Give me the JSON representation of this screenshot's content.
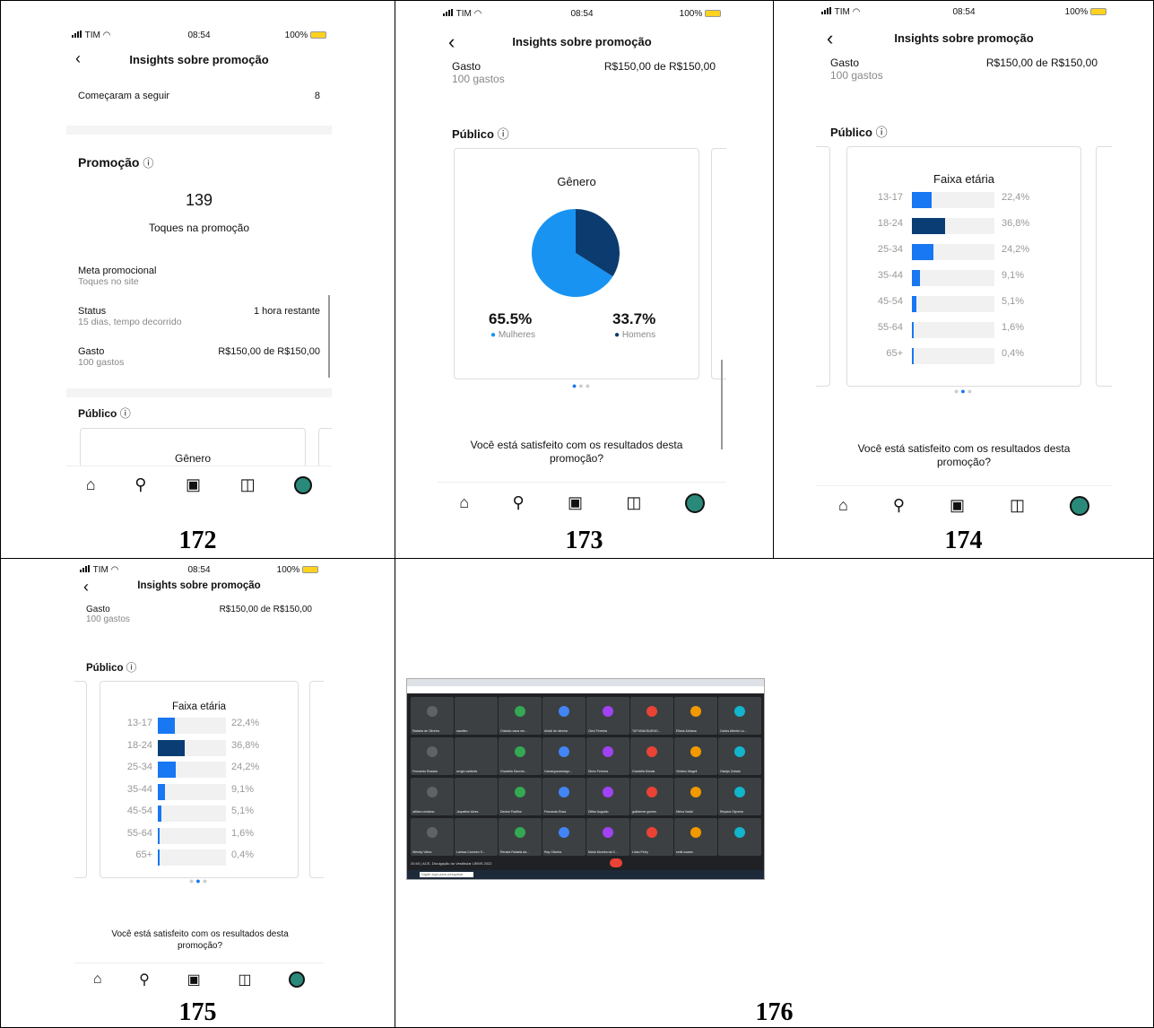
{
  "status": {
    "carrier": "TIM",
    "time": "08:54",
    "battery": "100%"
  },
  "header": {
    "title": "Insights sobre promoção"
  },
  "screens": {
    "s172": {
      "caption": "172",
      "follow_label": "Começaram a seguir",
      "follow_value": "8",
      "promo_title": "Promoção",
      "promo_value": "139",
      "promo_label": "Toques na promoção",
      "goal_label": "Meta promocional",
      "goal_sub": "Toques no site",
      "status_label": "Status",
      "status_sub": "15 dias, tempo decorrido",
      "status_value": "1 hora restante",
      "spend_label": "Gasto",
      "spend_sub": "100 gastos",
      "spend_value": "R$150,00 de R$150,00",
      "public_title": "Público",
      "gender_title": "Gênero"
    },
    "s173": {
      "caption": "173",
      "spend_label": "Gasto",
      "spend_sub": "100 gastos",
      "spend_value": "R$150,00 de R$150,00",
      "public_title": "Público",
      "gender_title": "Gênero",
      "women_pct": "65.5%",
      "women_label": "Mulheres",
      "men_pct": "33.7%",
      "men_label": "Homens",
      "question": "Você está satisfeito com os resultados desta promoção?"
    },
    "s174": {
      "caption": "174",
      "spend_label": "Gasto",
      "spend_sub": "100 gastos",
      "spend_value": "R$150,00 de R$150,00",
      "public_title": "Público",
      "age_title": "Faixa etária",
      "question": "Você está satisfeito com os resultados desta promoção?"
    },
    "s175": {
      "caption": "175",
      "spend_label": "Gasto",
      "spend_sub": "100 gastos",
      "spend_value": "R$150,00 de R$150,00",
      "public_title": "Público",
      "age_title": "Faixa etária",
      "question": "Você está satisfeito com os resultados desta promoção?"
    },
    "s176": {
      "caption": "176",
      "meeting_title": "ACE- Divulgação do Vestibular UEMS 2022",
      "meeting_time": "20:40",
      "search_placeholder": "Digite aqui para pesquisar"
    }
  },
  "age_groups": [
    {
      "label": "13-17",
      "pct_text": "22,4%",
      "value": 0.224,
      "color": "#1877f2"
    },
    {
      "label": "18-24",
      "pct_text": "36,8%",
      "value": 0.368,
      "color": "#0a3d73"
    },
    {
      "label": "25-34",
      "pct_text": "24,2%",
      "value": 0.242,
      "color": "#1877f2"
    },
    {
      "label": "35-44",
      "pct_text": "9,1%",
      "value": 0.091,
      "color": "#1877f2"
    },
    {
      "label": "45-54",
      "pct_text": "5,1%",
      "value": 0.051,
      "color": "#1877f2"
    },
    {
      "label": "55-64",
      "pct_text": "1,6%",
      "value": 0.016,
      "color": "#1877f2"
    },
    {
      "label": "65+",
      "pct_text": "0,4%",
      "value": 0.004,
      "color": "#1877f2"
    }
  ],
  "gender": {
    "women": 0.655,
    "men": 0.337,
    "women_color": "#1893f2",
    "men_color": "#0b3b6f"
  },
  "participants": [
    "Rafaela de Oliveira",
    "naurileo",
    "Orlando vana ver...",
    "Arladi de oliveira",
    "Cleci Ferreira",
    "TATYANA BUENO...",
    "Eliane Adriana",
    "Carlos Alberto Lo...",
    "Fernando Rosado",
    "sergio valdzels",
    "Graciella Dacche...",
    "Camargocamargo...",
    "Dinez Ferreira",
    "Graciella Morais",
    "Vinicius Mageli",
    "Gladys Zubala",
    "william cristiano",
    "Jaqueline Alves",
    "Denise Padilha",
    "Fernanda Rosa",
    "Diffas Augusto",
    "guilherme gomes",
    "Neiva Vadal",
    "Reyana Olyveira",
    "Wesley Vieira",
    "Larissa Carneiro S...",
    "Renata Rafaela da...",
    "Ray Oliveira",
    "Maria Moreira da S...",
    "Lirian Petry",
    "sebit soares",
    ""
  ],
  "icons": [
    "signal-icon",
    "wifi-icon",
    "battery-icon",
    "back-icon",
    "info-icon",
    "home-icon",
    "search-icon",
    "reels-icon",
    "shop-icon",
    "profile-icon"
  ]
}
